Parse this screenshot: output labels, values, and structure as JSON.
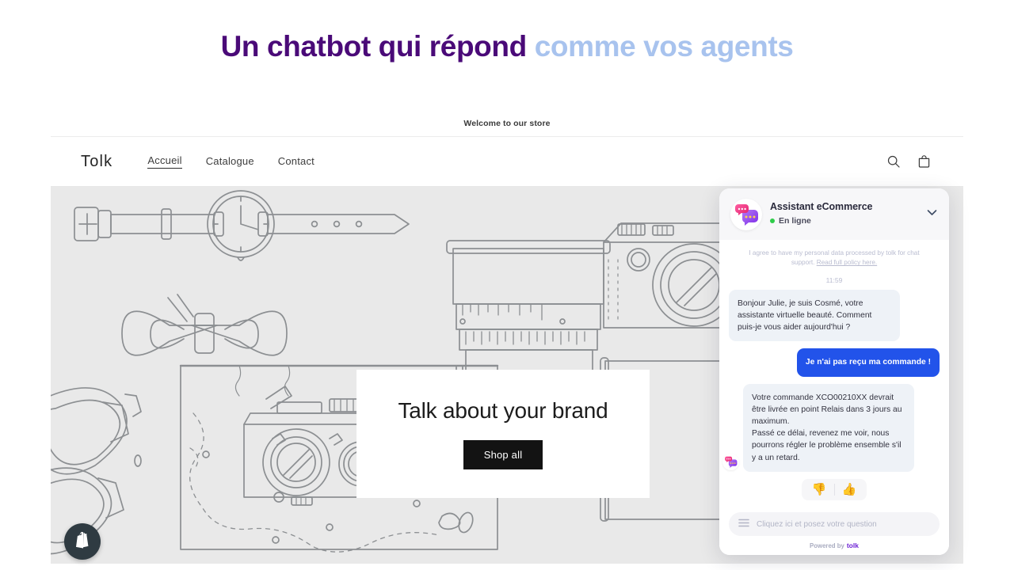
{
  "headline": {
    "part_dark": "Un chatbot qui répond",
    "part_light": "comme vos agents",
    "color_dark": "#4a0a78",
    "color_light": "#a8c3ee"
  },
  "store": {
    "announcement": "Welcome to our store",
    "brand": "Tolk",
    "nav": [
      {
        "label": "Accueil",
        "active": true
      },
      {
        "label": "Catalogue",
        "active": false
      },
      {
        "label": "Contact",
        "active": false
      }
    ],
    "icons": [
      {
        "name": "search-icon"
      },
      {
        "name": "cart-icon"
      }
    ],
    "hero": {
      "title": "Talk about your brand",
      "cta": "Shop all"
    },
    "shopify_badge": "shopify-icon"
  },
  "chat": {
    "title": "Assistant eCommerce",
    "status": "En ligne",
    "status_color": "#2fcc4a",
    "collapse_icon": "chevron-down-icon",
    "consent_text": "I agree to have my personal data processed by tolk for chat support. ",
    "consent_link": "Read full policy here.",
    "timestamp": "11:59",
    "messages": [
      {
        "from": "bot",
        "text": "Bonjour Julie, je suis Cosmé, votre assistante virtuelle beauté. Comment puis-je vous aider aujourd'hui ?"
      },
      {
        "from": "user",
        "text": "Je n'ai pas reçu ma commande !"
      },
      {
        "from": "bot",
        "text": "Votre commande XCO00210XX devrait être livrée en point Relais dans 3 jours au maximum.\nPassé ce délai, revenez me voir, nous pourrons régler le problème ensemble s'il y a un retard."
      }
    ],
    "reactions": [
      {
        "name": "thumbs-down",
        "glyph": "👎"
      },
      {
        "name": "thumbs-up",
        "glyph": "👍"
      }
    ],
    "input_placeholder": "Cliquez ici et posez votre question",
    "menu_icon": "hamburger-icon",
    "powered_prefix": "Powered by",
    "powered_brand": "tolk",
    "bubble_user_color": "#2253ea",
    "bubble_bot_color": "#eef2f7"
  }
}
